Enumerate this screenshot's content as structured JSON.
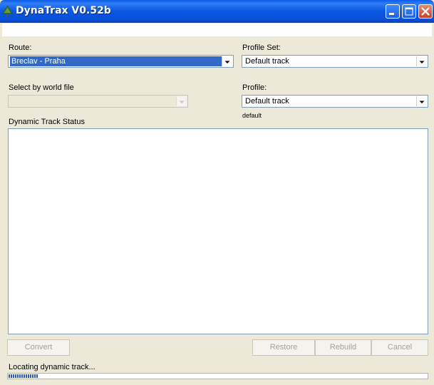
{
  "window": {
    "title": "DynaTrax V0.52b",
    "icon": "app-tree-icon",
    "controls": [
      "minimize-icon",
      "maximize-icon",
      "close-icon"
    ]
  },
  "route": {
    "label": "Route:",
    "selected": "Breclav - Praha"
  },
  "profile_set": {
    "label": "Profile Set:",
    "selected": "Default track"
  },
  "world_file": {
    "label": "Select by world file",
    "selected": ""
  },
  "profile": {
    "label": "Profile:",
    "selected": "Default track",
    "note": "default"
  },
  "status": {
    "label": "Dynamic Track Status"
  },
  "buttons": {
    "convert": "Convert",
    "restore": "Restore",
    "rebuild": "Rebuild",
    "cancel": "Cancel"
  },
  "footer": {
    "status_text": "Locating dynamic track...",
    "progress_fraction": 0.075
  },
  "colors": {
    "titlebar": "#0a5ce8",
    "selection": "#316ac5",
    "progress": "#2b59c8",
    "background": "#ece9d8"
  }
}
